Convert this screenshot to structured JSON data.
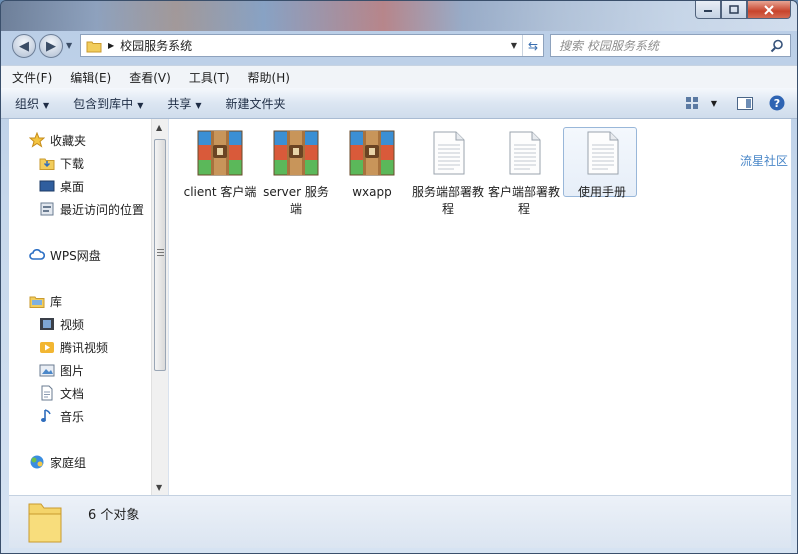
{
  "window": {
    "path_segment": "校园服务系统"
  },
  "search": {
    "placeholder": "搜索 校园服务系统"
  },
  "menu": [
    "文件(F)",
    "编辑(E)",
    "查看(V)",
    "工具(T)",
    "帮助(H)"
  ],
  "toolbar": {
    "organize": "组织",
    "include_in_library": "包含到库中",
    "share": "共享",
    "new_folder": "新建文件夹"
  },
  "nav": {
    "favorites": "收藏夹",
    "downloads": "下载",
    "desktop": "桌面",
    "recent": "最近访问的位置",
    "wps": "WPS网盘",
    "libraries": "库",
    "videos": "视频",
    "tencent_video": "腾讯视频",
    "pictures": "图片",
    "documents": "文档",
    "music": "音乐",
    "homegroup": "家庭组"
  },
  "files": [
    {
      "name": "client 客户端",
      "type": "archive"
    },
    {
      "name": "server 服务端",
      "type": "archive"
    },
    {
      "name": "wxapp",
      "type": "archive"
    },
    {
      "name": "服务端部署教程",
      "type": "text"
    },
    {
      "name": "客户端部署教程",
      "type": "text"
    },
    {
      "name": "使用手册",
      "type": "text",
      "selected": true
    }
  ],
  "status": {
    "count_text": "6 个对象"
  },
  "watermark": "流星社区"
}
